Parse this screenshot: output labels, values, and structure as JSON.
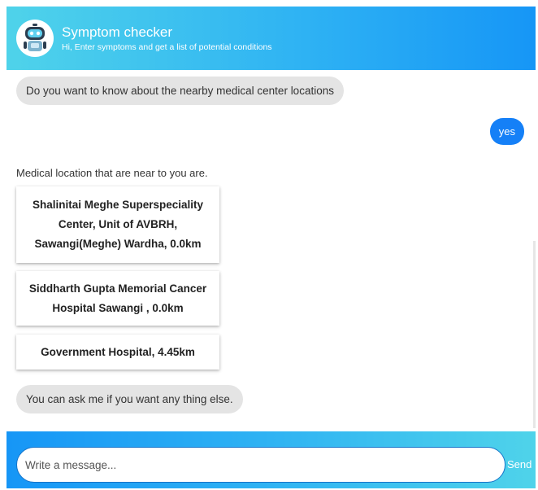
{
  "header": {
    "title": "Symptom checker",
    "subtitle": "Hi, Enter symptoms and get a list of potential conditions",
    "avatar_icon": "robot-icon"
  },
  "messages": {
    "bot_question": "Do you want to know about the nearby medical center locations",
    "user_reply": "yes",
    "bot_intro": "Medical location that are near to you are.",
    "locations": [
      "Shalinitai Meghe Superspeciality Center, Unit of AVBRH, Sawangi(Meghe) Wardha, 0.0km",
      "Siddharth Gupta Memorial Cancer Hospital Sawangi , 0.0km",
      "Government Hospital, 4.45km"
    ],
    "bot_followup": "You can ask me if you want any thing else."
  },
  "composer": {
    "placeholder": "Write a message...",
    "send_label": "Send"
  },
  "colors": {
    "header_gradient_start": "#4fd3ea",
    "header_gradient_end": "#1696f6",
    "user_bubble": "#1580f7",
    "bot_bubble": "#e4e4e4"
  }
}
